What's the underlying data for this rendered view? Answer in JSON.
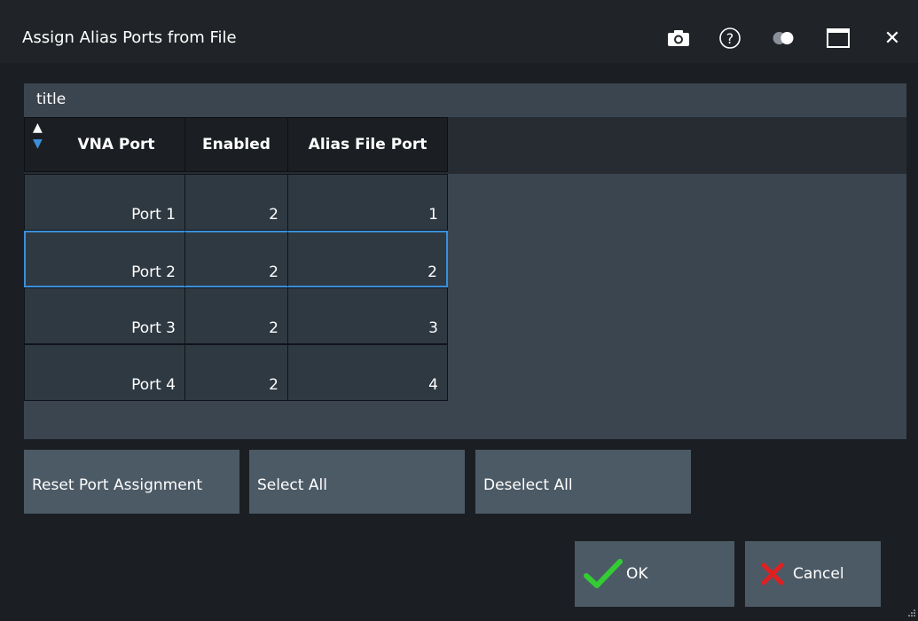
{
  "window": {
    "title": "Assign Alias Ports from File",
    "icons": [
      "camera-icon",
      "help-icon",
      "toggle-icon",
      "maximize-icon",
      "close-icon"
    ],
    "help_glyph": "?",
    "close_glyph": "✕"
  },
  "panel": {
    "title": "title"
  },
  "table": {
    "sort_up": "▲",
    "sort_down": "▼",
    "columns": [
      "VNA Port",
      "Enabled",
      "Alias File Port"
    ],
    "rows": [
      {
        "vna_port": "Port 1",
        "enabled": "2",
        "alias_port": "1"
      },
      {
        "vna_port": "Port 2",
        "enabled": "2",
        "alias_port": "2"
      },
      {
        "vna_port": "Port 3",
        "enabled": "2",
        "alias_port": "3"
      },
      {
        "vna_port": "Port 4",
        "enabled": "2",
        "alias_port": "4"
      }
    ]
  },
  "buttons": {
    "reset": "Reset Port Assignment",
    "select_all": "Select All",
    "deselect_all": "Deselect All",
    "ok": "OK",
    "cancel": "Cancel"
  },
  "colors": {
    "accent": "#3a8fd9",
    "ok_check": "#33cc33",
    "cancel_x": "#e02020"
  }
}
